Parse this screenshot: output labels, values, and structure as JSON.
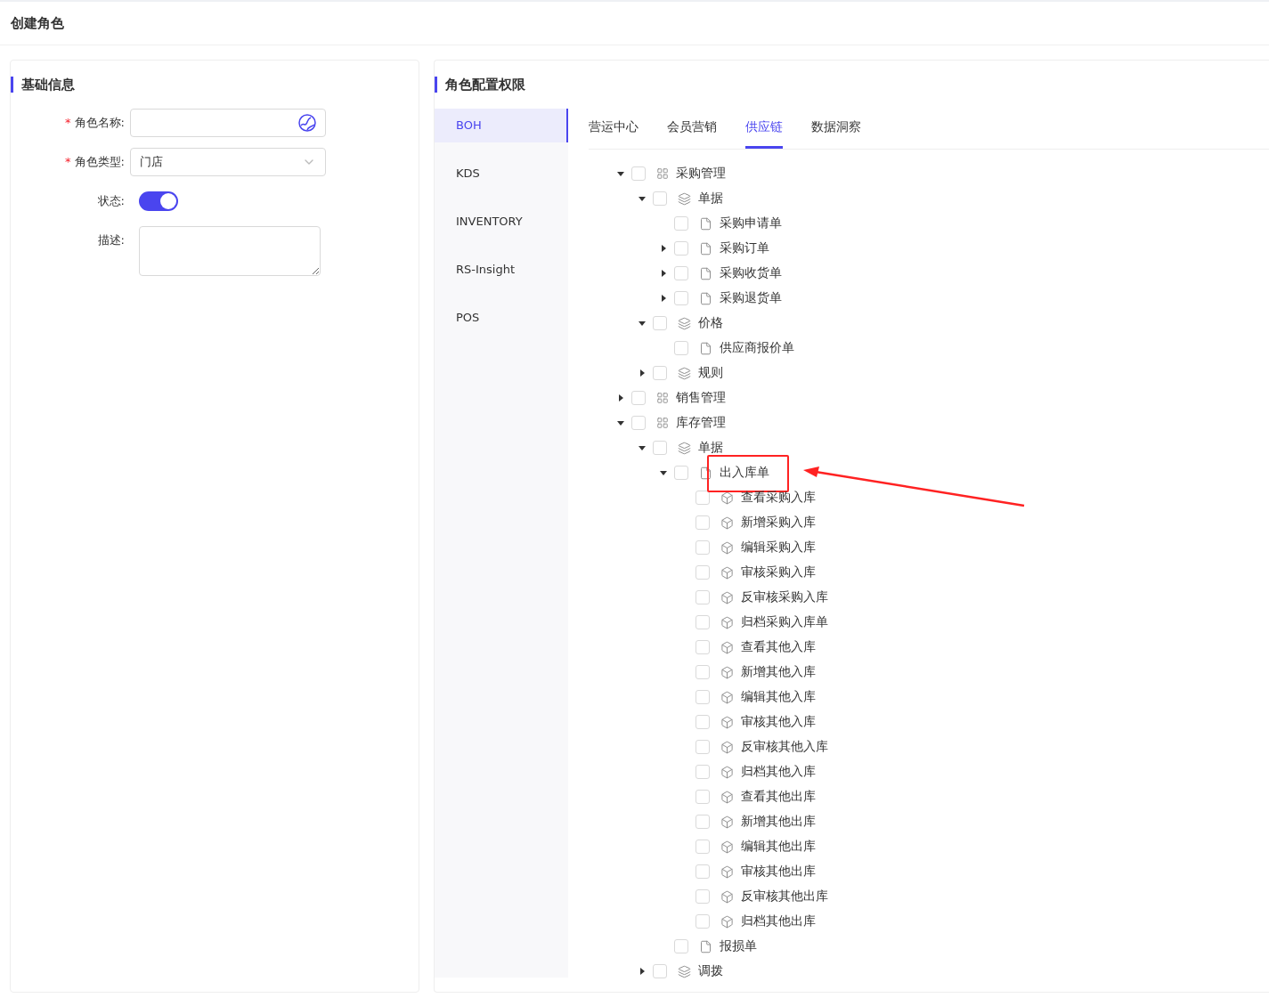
{
  "page_title": "创建角色",
  "basic_info": {
    "title": "基础信息",
    "fields": [
      {
        "kind": "input",
        "label": "角色名称:",
        "required_mark": "*"
      },
      {
        "kind": "select",
        "label": "角色类型:",
        "required_mark": "*",
        "value": "门店"
      },
      {
        "kind": "switch",
        "label": "状态:",
        "on": true
      },
      {
        "kind": "textarea",
        "label": "描述:"
      }
    ]
  },
  "permissions": {
    "title": "角色配置权限",
    "systems": [
      {
        "label": "BOH",
        "selected": true
      },
      {
        "label": "KDS",
        "selected": false
      },
      {
        "label": "INVENTORY",
        "selected": false
      },
      {
        "label": "RS-Insight",
        "selected": false
      },
      {
        "label": "POS",
        "selected": false
      }
    ],
    "tabs": [
      {
        "label": "营运中心",
        "selected": false
      },
      {
        "label": "会员营销",
        "selected": false
      },
      {
        "label": "供应链",
        "selected": true
      },
      {
        "label": "数据洞察",
        "selected": false
      }
    ],
    "tree": [
      {
        "kind": "module",
        "label": "采购管理",
        "checked": false,
        "expanded": true,
        "children": [
          {
            "kind": "group",
            "label": "单据",
            "checked": false,
            "expanded": true,
            "children": [
              {
                "kind": "doc",
                "label": "采购申请单",
                "checked": false
              },
              {
                "kind": "doc",
                "label": "采购订单",
                "checked": false,
                "expanded": false
              },
              {
                "kind": "doc",
                "label": "采购收货单",
                "checked": false,
                "expanded": false
              },
              {
                "kind": "doc",
                "label": "采购退货单",
                "checked": false,
                "expanded": false
              }
            ]
          },
          {
            "kind": "group",
            "label": "价格",
            "checked": false,
            "expanded": true,
            "children": [
              {
                "kind": "doc",
                "label": "供应商报价单",
                "checked": false
              }
            ]
          },
          {
            "kind": "group",
            "label": "规则",
            "checked": false,
            "expanded": false
          }
        ]
      },
      {
        "kind": "module",
        "label": "销售管理",
        "checked": false,
        "expanded": false
      },
      {
        "kind": "module",
        "label": "库存管理",
        "checked": false,
        "expanded": true,
        "children": [
          {
            "kind": "group",
            "label": "单据",
            "checked": false,
            "expanded": true,
            "children": [
              {
                "kind": "doc",
                "label": "出入库单",
                "checked": false,
                "expanded": true,
                "highlighted": true,
                "children": [
                  {
                    "kind": "action",
                    "label": "查看采购入库",
                    "checked": false
                  },
                  {
                    "kind": "action",
                    "label": "新增采购入库",
                    "checked": false
                  },
                  {
                    "kind": "action",
                    "label": "编辑采购入库",
                    "checked": false
                  },
                  {
                    "kind": "action",
                    "label": "审核采购入库",
                    "checked": false
                  },
                  {
                    "kind": "action",
                    "label": "反审核采购入库",
                    "checked": false
                  },
                  {
                    "kind": "action",
                    "label": "归档采购入库单",
                    "checked": false
                  },
                  {
                    "kind": "action",
                    "label": "查看其他入库",
                    "checked": false
                  },
                  {
                    "kind": "action",
                    "label": "新增其他入库",
                    "checked": false
                  },
                  {
                    "kind": "action",
                    "label": "编辑其他入库",
                    "checked": false
                  },
                  {
                    "kind": "action",
                    "label": "审核其他入库",
                    "checked": false
                  },
                  {
                    "kind": "action",
                    "label": "反审核其他入库",
                    "checked": false
                  },
                  {
                    "kind": "action",
                    "label": "归档其他入库",
                    "checked": false
                  },
                  {
                    "kind": "action",
                    "label": "查看其他出库",
                    "checked": false
                  },
                  {
                    "kind": "action",
                    "label": "新增其他出库",
                    "checked": false
                  },
                  {
                    "kind": "action",
                    "label": "编辑其他出库",
                    "checked": false
                  },
                  {
                    "kind": "action",
                    "label": "审核其他出库",
                    "checked": false
                  },
                  {
                    "kind": "action",
                    "label": "反审核其他出库",
                    "checked": false
                  },
                  {
                    "kind": "action",
                    "label": "归档其他出库",
                    "checked": false
                  }
                ]
              },
              {
                "kind": "doc",
                "label": "报损单",
                "checked": false
              }
            ]
          },
          {
            "kind": "group",
            "label": "调拨",
            "checked": false,
            "expanded": false
          }
        ]
      }
    ]
  }
}
